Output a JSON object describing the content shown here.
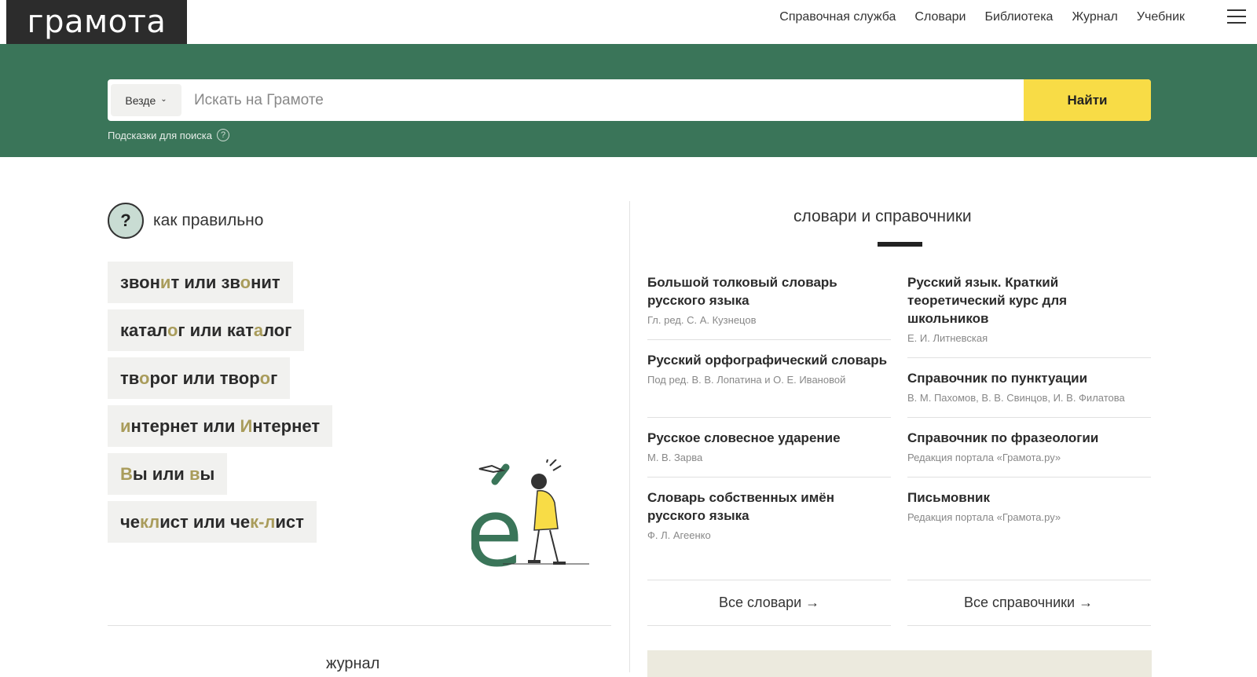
{
  "header": {
    "logo": "грамота",
    "nav": [
      "Справочная служба",
      "Словари",
      "Библиотека",
      "Журнал",
      "Учебник"
    ]
  },
  "search": {
    "scope": "Везде",
    "placeholder": "Искать на Грамоте",
    "button": "Найти",
    "hints": "Подсказки для поиска"
  },
  "how": {
    "title": "как правильно",
    "pairs": [
      [
        {
          "t": "звон"
        },
        {
          "t": "и",
          "a": 1
        },
        {
          "t": "т или зв"
        },
        {
          "t": "о",
          "a": 1
        },
        {
          "t": "нит"
        }
      ],
      [
        {
          "t": "катал"
        },
        {
          "t": "о",
          "a": 1
        },
        {
          "t": "г или кат"
        },
        {
          "t": "а",
          "a": 1
        },
        {
          "t": "лог"
        }
      ],
      [
        {
          "t": "тв"
        },
        {
          "t": "о",
          "a": 1
        },
        {
          "t": "рог или твор"
        },
        {
          "t": "о",
          "a": 1
        },
        {
          "t": "г"
        }
      ],
      [
        {
          "t": "и",
          "a": 1
        },
        {
          "t": "нтернет или "
        },
        {
          "t": "И",
          "a": 1
        },
        {
          "t": "нтернет"
        }
      ],
      [
        {
          "t": "В",
          "a": 1
        },
        {
          "t": "ы или "
        },
        {
          "t": "в",
          "a": 1
        },
        {
          "t": "ы"
        }
      ],
      [
        {
          "t": "че"
        },
        {
          "t": "кл",
          "a": 1
        },
        {
          "t": "ист или че"
        },
        {
          "t": "к-л",
          "a": 1
        },
        {
          "t": "ист"
        }
      ]
    ]
  },
  "dictionaries": {
    "title": "словари и справочники",
    "left": [
      {
        "name": "Большой толковый словарь русского языка",
        "author": "Гл. ред. С. А. Кузнецов"
      },
      {
        "name": "Русский орфографический словарь",
        "author": "Под ред. В. В. Лопатина и О. Е. Ивановой"
      },
      {
        "name": "Русское словесное ударение",
        "author": "М. В. Зарва"
      },
      {
        "name": "Словарь собственных имён русского языка",
        "author": "Ф. Л. Агеенко"
      }
    ],
    "right": [
      {
        "name": "Русский язык. Краткий теоретический курс для школьников",
        "author": "Е. И. Литневская"
      },
      {
        "name": "Справочник по пунктуации",
        "author": "В. М. Пахомов, В. В. Свинцов, И. В. Филатова"
      },
      {
        "name": "Справочник по фразеологии",
        "author": "Редакция портала «Грамота.ру»"
      },
      {
        "name": "Письмовник",
        "author": "Редакция портала «Грамота.ру»"
      }
    ],
    "all_dicts": "Все словари →",
    "all_refs": "Все справочники →"
  },
  "journal": {
    "title": "журнал"
  },
  "colors": {
    "brand_green": "#3a7559",
    "button_yellow": "#f8dc46",
    "accent_olive": "#a99c5b"
  }
}
